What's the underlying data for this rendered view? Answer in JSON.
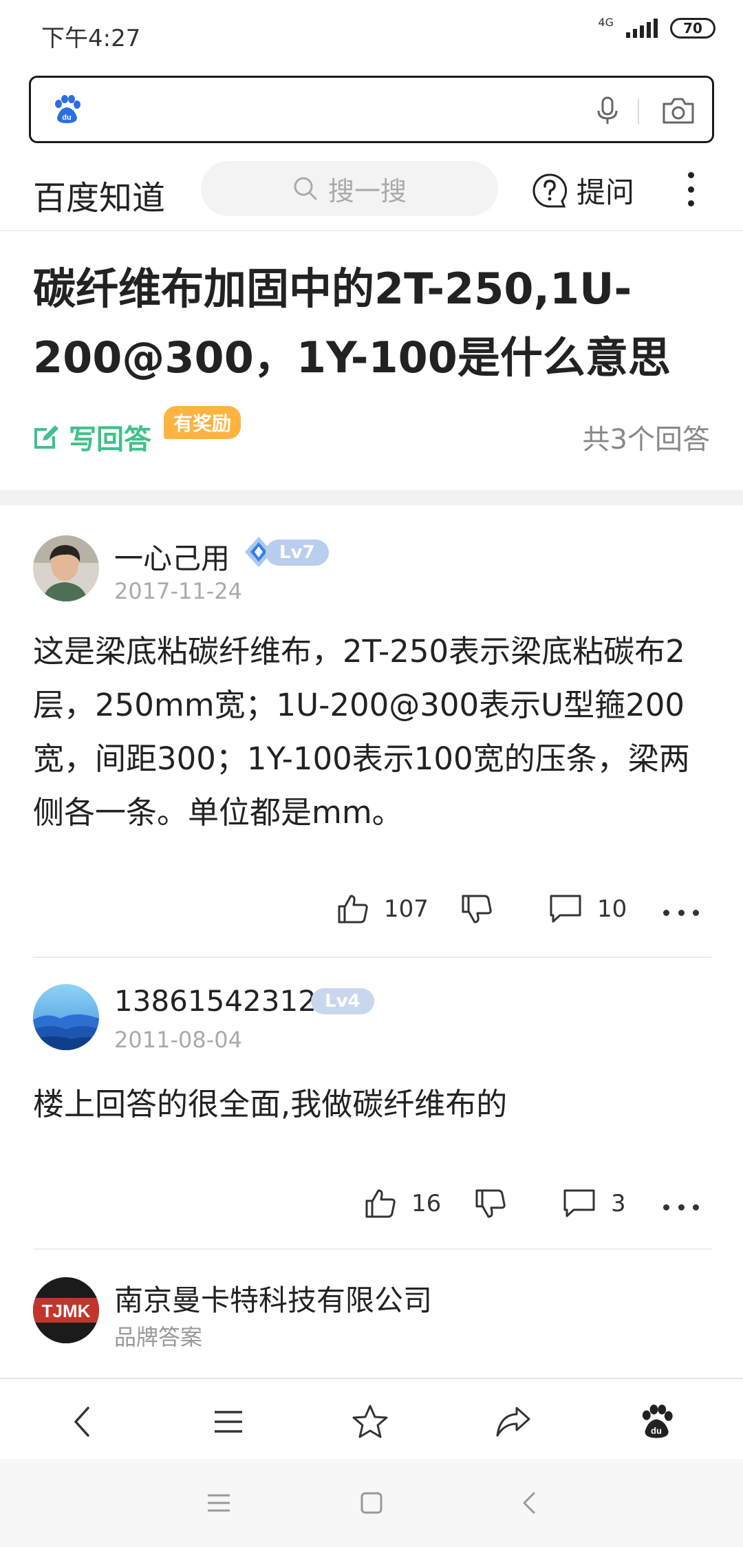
{
  "status_bar": {
    "time": "下午4:27",
    "network": "4G",
    "battery": "70"
  },
  "search_box": {
    "logo": "du-paw-icon",
    "mic": "mic-icon",
    "camera": "camera-icon"
  },
  "header": {
    "brand": "百度知道",
    "search_placeholder": "搜一搜",
    "ask_label": "提问"
  },
  "question": {
    "title": "碳纤维布加固中的2T-250,1U-200@300，1Y-100是什么意思",
    "write_answer": "写回答",
    "reward_badge": "有奖励",
    "answer_count": "共3个回答"
  },
  "answers": [
    {
      "user": "一心己用",
      "level": "Lv7",
      "date": "2017-11-24",
      "text": "这是梁底粘碳纤维布，2T-250表示梁底粘碳布2层，250mm宽；1U-200@300表示U型箍200宽，间距300；1Y-100表示100宽的压条，梁两侧各一条。单位都是mm。",
      "likes": "107",
      "comments": "10"
    },
    {
      "user": "13861542312",
      "level": "Lv4",
      "date": "2011-08-04",
      "text": "楼上回答的很全面,我做碳纤维布的",
      "likes": "16",
      "comments": "3"
    },
    {
      "user": "南京曼卡特科技有限公司",
      "subtitle": "品牌答案",
      "avatar_text": "TJMK"
    }
  ],
  "toolbar": [
    "back-icon",
    "menu-icon",
    "star-icon",
    "share-icon",
    "du-paw-icon"
  ],
  "nav_bar": [
    "recent-apps-icon",
    "home-icon",
    "nav-back-icon"
  ],
  "colors": {
    "green": "#3ec18a",
    "reward": "#ffb340",
    "level_badge": "#c9d7ee",
    "baidu_blue": "#2b6ee6"
  }
}
